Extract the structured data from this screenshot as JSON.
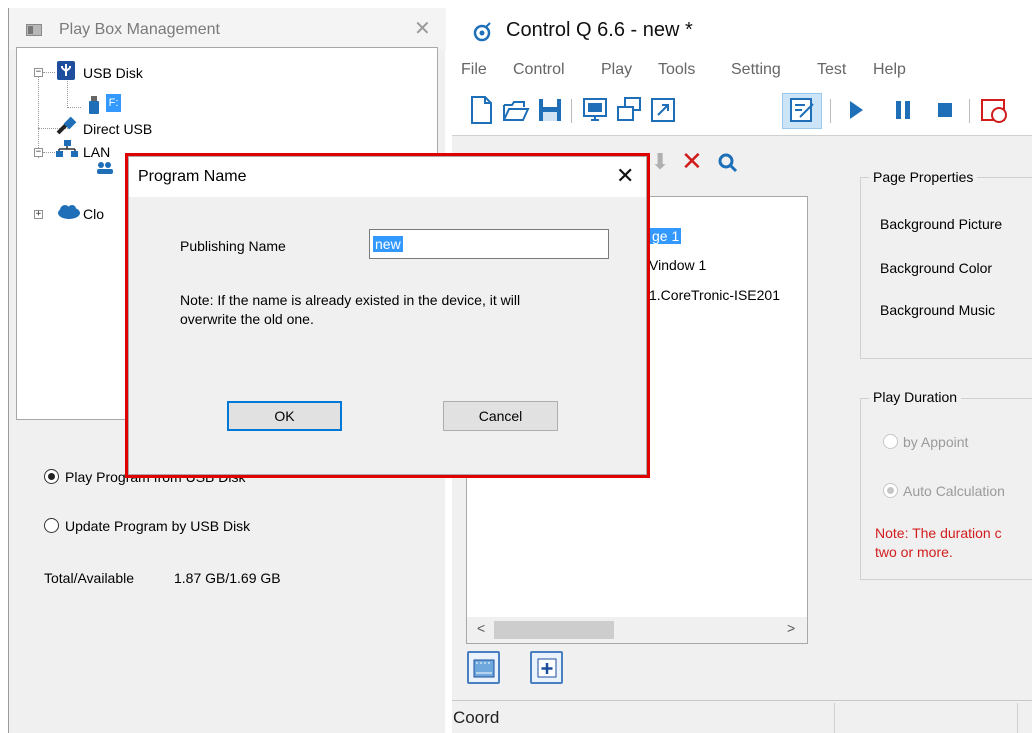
{
  "left_panel": {
    "title": "Play Box Management",
    "tree": {
      "usb_disk": "USB Disk",
      "drive": "F:",
      "direct_usb": "Direct USB",
      "lan": "LAN",
      "cloud": "Clo"
    },
    "radio_play_usb": "Play Program from USB Disk",
    "radio_update_usb": "Update Program by USB Disk",
    "total_available_label": "Total/Available",
    "total_available_value": "1.87 GB/1.69 GB"
  },
  "app": {
    "title": "Control Q 6.6 - new *",
    "menu": [
      "File",
      "Control",
      "Play",
      "Tools",
      "Setting",
      "Test",
      "Help"
    ]
  },
  "program_list": {
    "items": [
      "ge 1",
      "Vindow 1",
      "1.CoreTronic-ISE201"
    ]
  },
  "properties": {
    "page_properties_title": "Page Properties",
    "background_picture": "Background Picture",
    "background_color": "Background Color",
    "background_music": "Background Music",
    "play_duration_title": "Play Duration",
    "by_appoint": "by Appoint",
    "auto_calculation": "Auto Calculation",
    "note_line1": "Note: The duration c",
    "note_line2": "two or more."
  },
  "status_bar": {
    "coord_label": "Coord"
  },
  "dialog": {
    "title": "Program Name",
    "label": "Publishing Name",
    "input_value": "new",
    "note_line1": "Note: If the name is already existed in the device, it will",
    "note_line2": "overwrite the old one.",
    "ok": "OK",
    "cancel": "Cancel"
  },
  "colors": {
    "accent": "#0078d7",
    "selection": "#3399ff",
    "highlight_border": "#e00000",
    "note_red": "#d21d1d",
    "toolbar_blue": "#1e6fb8"
  }
}
